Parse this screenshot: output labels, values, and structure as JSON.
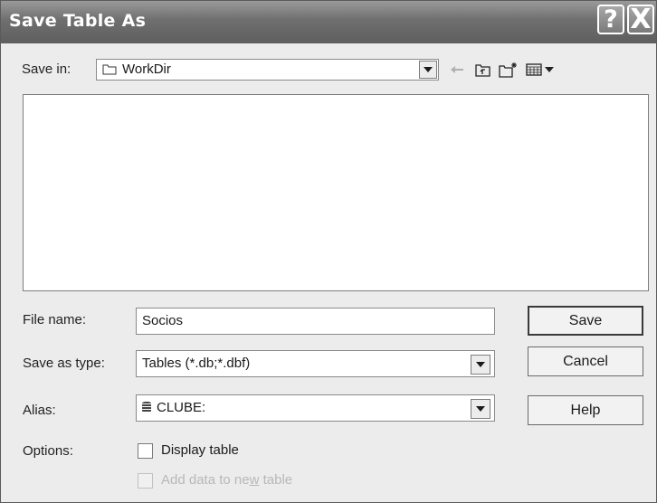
{
  "window": {
    "title": "Save Table As",
    "help_glyph": "?",
    "close_glyph": "X"
  },
  "save_in": {
    "label": "Save in:",
    "value": "WorkDir",
    "icon": "folder-icon"
  },
  "toolbar_icons": [
    "back-arrow-icon",
    "up-one-level-icon",
    "new-folder-icon",
    "view-menu-icon"
  ],
  "file_name": {
    "label": "File name:",
    "value": "Socios"
  },
  "save_as_type": {
    "label": "Save as type:",
    "value": "Tables (*.db;*.dbf)"
  },
  "alias": {
    "label": "Alias:",
    "value": "CLUBE:",
    "icon": "database-icon"
  },
  "options": {
    "label": "Options:",
    "display_table": {
      "label": "Display table",
      "checked": false,
      "enabled": true
    },
    "add_data": {
      "label_pre": "Add data to ne",
      "label_u": "w",
      "label_post": " table",
      "checked": false,
      "enabled": false
    }
  },
  "buttons": {
    "save": "Save",
    "cancel": "Cancel",
    "help": "Help"
  },
  "colors": {
    "title_bar": "#6f6f6f",
    "dialog_bg": "#ececec",
    "disabled_text": "#b8b8b8"
  }
}
